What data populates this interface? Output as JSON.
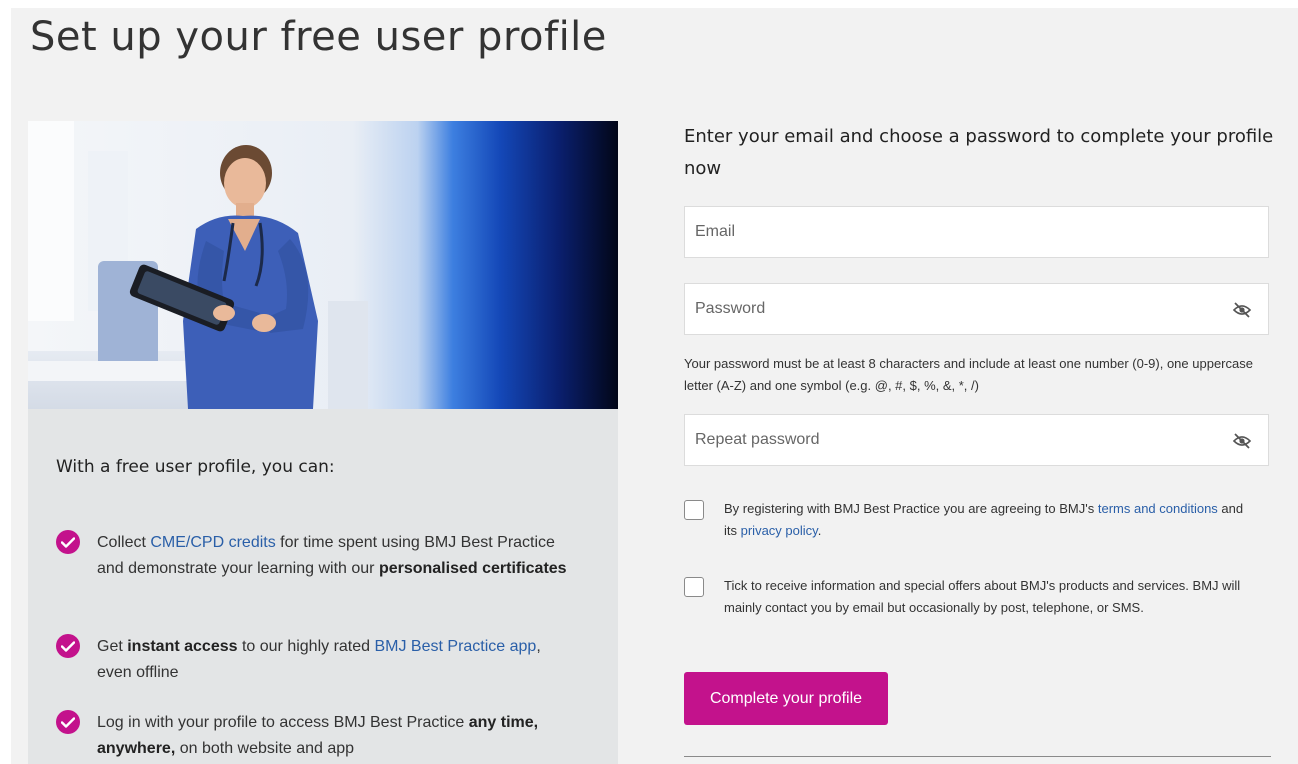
{
  "page": {
    "title": "Set up your free user profile"
  },
  "benefits": {
    "heading": "With a free user profile, you can:",
    "items": [
      {
        "pre": "Collect ",
        "link": "CME/CPD credits",
        "mid": " for time spent using BMJ Best Practice and demonstrate your learning with our ",
        "bold": "personalised certificates",
        "post": ""
      },
      {
        "pre": "Get ",
        "bold": "instant access",
        "mid": " to our highly rated ",
        "link": "BMJ Best Practice app",
        "post": ", even offline"
      },
      {
        "pre": "Log in with your profile to access BMJ Best Practice ",
        "bold": "any time, anywhere,",
        "post": " on both website and app"
      }
    ]
  },
  "form": {
    "heading": "Enter your email and choose a password to complete your profile now",
    "email_placeholder": "Email",
    "password_placeholder": "Password",
    "password_hint": "Your password must be at least 8 characters and include at least one number (0-9), one uppercase letter (A-Z) and one symbol (e.g. @, #, $, %, &, *, /)",
    "repeat_placeholder": "Repeat password",
    "terms": {
      "pre": "By registering with BMJ Best Practice you are agreeing to BMJ's ",
      "terms_link": "terms and conditions",
      "mid": " and its ",
      "privacy_link": "privacy policy",
      "post": "."
    },
    "marketing_text": "Tick to receive information and special offers about BMJ's products and services. BMJ will mainly contact you by email but occasionally by post, telephone, or SMS.",
    "terms_checked": false,
    "marketing_checked": false,
    "submit_label": "Complete your profile"
  },
  "icons": {
    "check": "checkmark-icon",
    "visibility": "eye-slash-icon"
  },
  "colors": {
    "accent": "#c3128c",
    "link": "#2a5fa8",
    "panel": "#e3e5e6",
    "background": "#f2f2f2"
  }
}
